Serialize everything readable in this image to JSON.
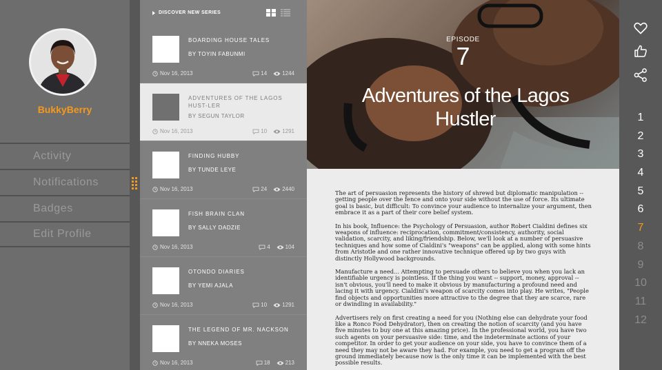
{
  "profile": {
    "username": "BukkyBerry"
  },
  "nav": {
    "items": [
      "Activity",
      "Notifications",
      "Badges",
      "Edit Profile"
    ]
  },
  "list": {
    "header": "DISCOVER NEW SERIES",
    "items": [
      {
        "title": "BOARDING HOUSE TALES",
        "author": "BY TOYIN FABUNMI",
        "date": "Nov 16, 2013",
        "comments": "14",
        "views": "1244"
      },
      {
        "title": "ADVENTURES OF THE LAGOS HUST-LER",
        "author": "BY SEGUN TAYLOR",
        "date": "Nov 16, 2013",
        "comments": "10",
        "views": "1291"
      },
      {
        "title": "FINDING HUBBY",
        "author": "BY TUNDE LEYE",
        "date": "Nov 16, 2013",
        "comments": "24",
        "views": "2440"
      },
      {
        "title": "FISH BRAIN CLAN",
        "author": "BY SALLY DADZIE",
        "date": "Nov 16, 2013",
        "comments": "4",
        "views": "104"
      },
      {
        "title": "OTONDO DIARIES",
        "author": "BY YEMI AJALA",
        "date": "Nov 16, 2013",
        "comments": "10",
        "views": "1291"
      },
      {
        "title": "THE LEGEND OF MR. NACKSON",
        "author": "BY NNEKA MOSES",
        "date": "Nov 16, 2013",
        "comments": "18",
        "views": "213"
      }
    ]
  },
  "hero": {
    "episode_label": "EPISODE",
    "episode_number": "7",
    "title": "Adventures of the Lagos Hustler"
  },
  "article": {
    "paragraphs": [
      "The art of persuasion represents the history of shrewd but diplomatic manipulation -- getting people over the fence and onto your side without the use of force. Its ultimate goal is basic, but difficult: To convince your audience to internalize your argument, then embrace it as a part of their core belief system.",
      "In his book, Influence: the Psychology of Persuasion, author Robert Cialdini defines six weapons of influence: reciprocation, commitment/consistency, authority, social validation, scarcity, and liking/friendship. Below, we'll look at a number of persuasive techniques and how some of Cialdini's \"weapons\" can be applied, along with some hints from Aristotle and one rather innovative technique offered up by two guys with distinctly Hollywood backgrounds.",
      "Manufacture a need... Attempting to persuade others to believe you when you lack an identifiable urgency is pointless. If the thing you want -- support, money, approval -- isn't obvious, you'll need to make it obvious by manufacturing a profound need and lacing it with urgency. Cialdini's weapon of scarcity comes into play. He writes, \"People find objects and opportunities more attractive to the degree that they are scarce, rare or dwindling in availability.\"",
      "Advertisers rely on first creating a need for you (Nothing else can dehydrate your food like a Ronco Food Dehydrator), then on creating the notion of scarcity (and you have five minutes to buy one at this amazing price). In the professional world, you have two such agents on your persuasive side: time, and the indeterminate actions of your competitor. In order to get your audience on your side, you have to convince them of a need they may not be aware they had. For example, you need to get a program off the ground immediately because now is the only time it can be implemented with the best possible results."
    ]
  },
  "episodes": {
    "numbers": [
      "1",
      "2",
      "3",
      "4",
      "5",
      "6",
      "7",
      "8",
      "9",
      "10",
      "11",
      "12"
    ],
    "current": 7,
    "available_through": 7
  },
  "icons": {
    "rail": [
      "heart-icon",
      "thumbs-up-icon",
      "share-icon"
    ],
    "list_meta": [
      "clock-icon",
      "comment-icon",
      "eye-icon"
    ]
  },
  "colors": {
    "accent": "#f39a1f",
    "sidebar": "#6d6d6d",
    "list": "#808080",
    "rail": "#585858"
  }
}
